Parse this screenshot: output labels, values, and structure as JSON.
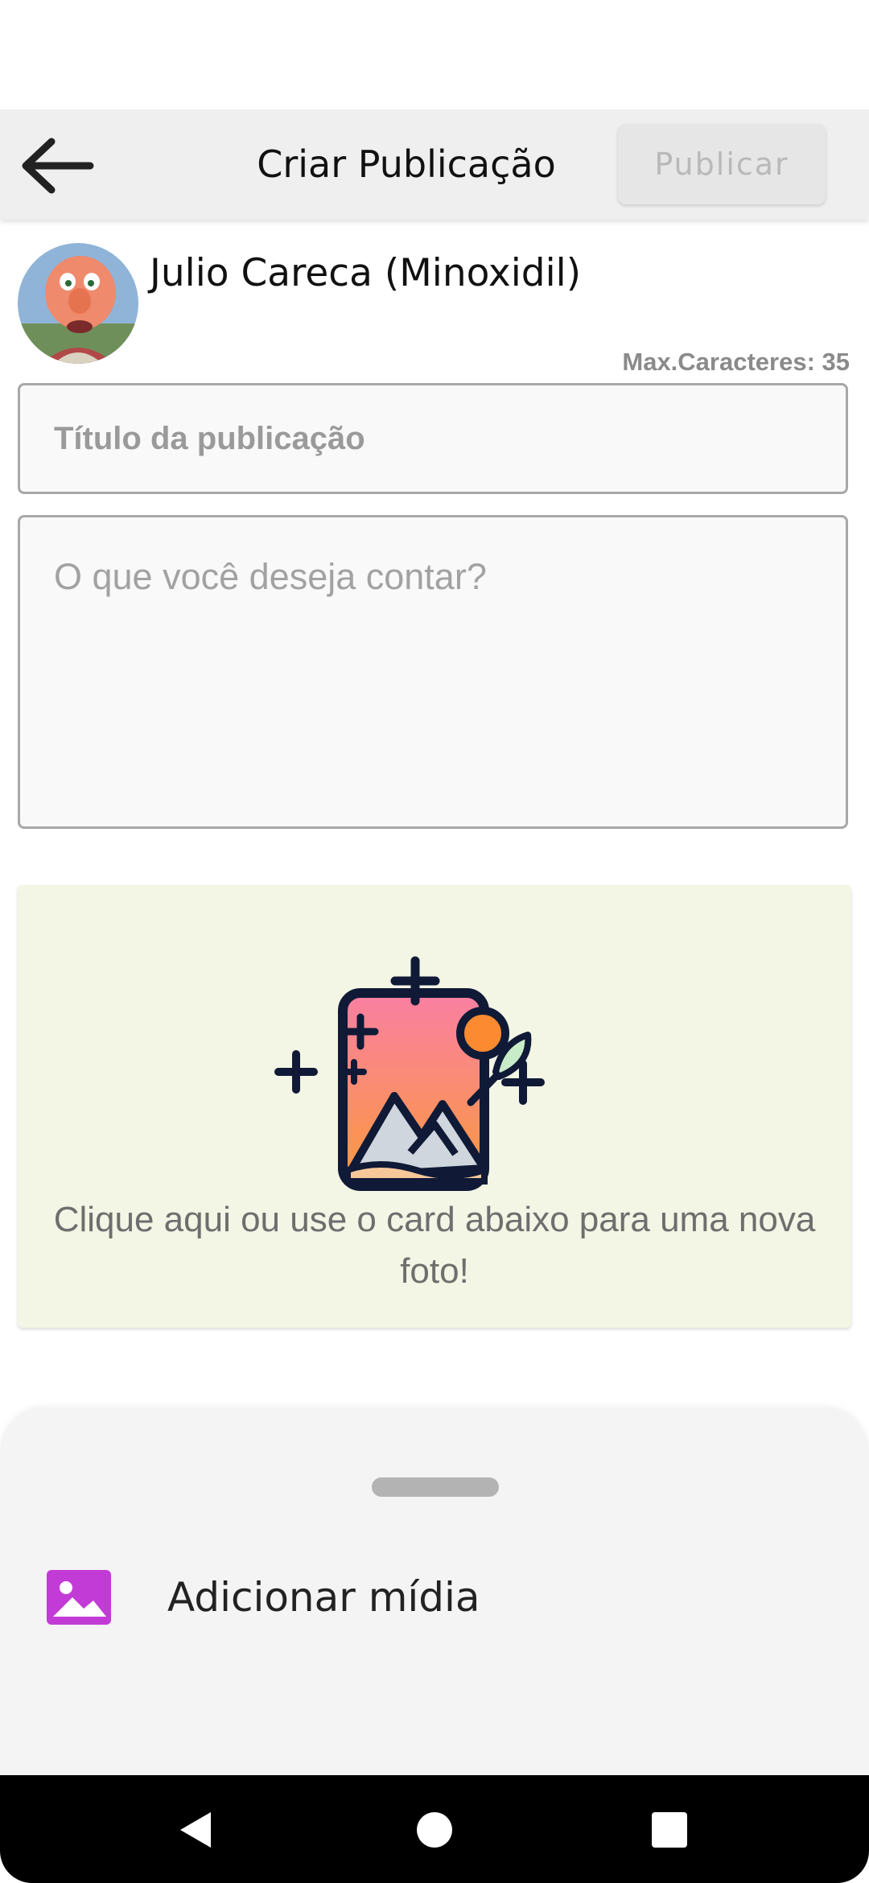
{
  "header": {
    "title": "Criar Publicação",
    "publish_label": "Publicar"
  },
  "author": {
    "name": "Julio Careca (Minoxidil)"
  },
  "form": {
    "char_counter": "Max.Caracteres: 35",
    "title_placeholder": "Título da publicação",
    "body_placeholder": "O que você deseja contar?"
  },
  "photo_card": {
    "caption": "Clique aqui ou use o card abaixo para uma nova foto!"
  },
  "bottom_sheet": {
    "add_media_label": "Adicionar mídia"
  },
  "colors": {
    "app_bar": "#efefef",
    "photo_card_bg": "#f3f5e5",
    "media_icon": "#c33bd6",
    "nav_bar": "#000000"
  },
  "icons": {
    "back": "arrow-left-icon",
    "add_media": "image-icon",
    "nav_back": "triangle-back-icon",
    "nav_home": "circle-home-icon",
    "nav_recents": "square-recents-icon"
  }
}
